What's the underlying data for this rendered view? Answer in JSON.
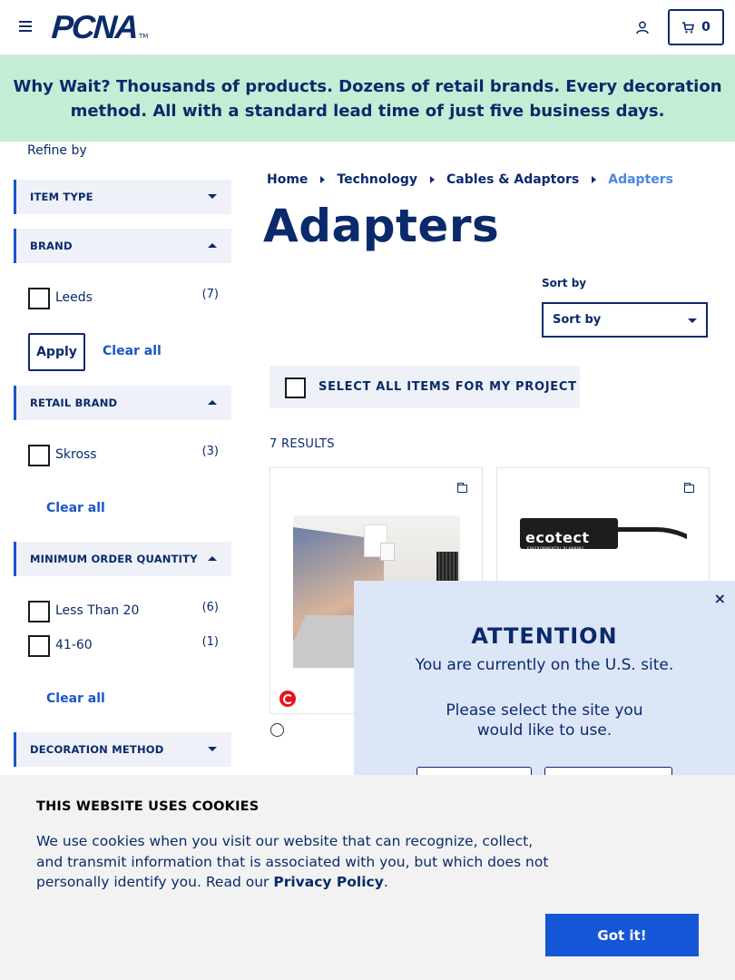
{
  "header": {
    "logo_text": "PCNA",
    "logo_tm": "TM",
    "cart_count": "0"
  },
  "promo": {
    "lead": "Why Wait?",
    "text": " Thousands of products. Dozens of retail brands. Every decoration method. All with a standard lead time of just five business days."
  },
  "sidebar": {
    "refine_label": "Refine by",
    "facets": {
      "item_type": {
        "label": "ITEM TYPE"
      },
      "brand": {
        "label": "BRAND",
        "options": [
          {
            "label": "Leeds",
            "count": "(7)"
          }
        ],
        "apply_label": "Apply",
        "clear_label": "Clear all"
      },
      "retail_brand": {
        "label": "RETAIL BRAND",
        "options": [
          {
            "label": "Skross",
            "count": "(3)"
          }
        ],
        "clear_label": "Clear all"
      },
      "min_order": {
        "label": "MINIMUM ORDER QUANTITY",
        "options": [
          {
            "label": "Less Than 20",
            "count": "(6)"
          },
          {
            "label": "41-60",
            "count": "(1)"
          }
        ],
        "clear_label": "Clear all"
      },
      "decoration": {
        "label": "DECORATION METHOD"
      }
    }
  },
  "main": {
    "breadcrumb": [
      "Home",
      "Technology",
      "Cables & Adaptors",
      "Adapters"
    ],
    "title": "Adapters",
    "sort_label": "Sort by",
    "sort_value": "Sort by",
    "select_all_label": "SELECT ALL ITEMS FOR MY PROJECT",
    "results": "7 RESULTS",
    "products": [
      {
        "image_brand": ""
      },
      {
        "image_brand": "ecotect",
        "image_sub": "ENVIRONMENTAL PLANNING"
      }
    ]
  },
  "modal": {
    "title": "ATTENTION",
    "line1": "You are currently on the U.S. site.",
    "line2a": "Please select the site you",
    "line2b": "would like to use.",
    "close": "×"
  },
  "cookie": {
    "title": "THIS WEBSITE USES COOKIES",
    "body": "We use cookies when you visit our website that can recognize, collect, and transmit information that is associated with you, but which does not personally identify you. Read our ",
    "link": "Privacy Policy",
    "end": ".",
    "button": "Got it!"
  },
  "colors": {
    "navy": "#0a2a6b",
    "accent": "#1956c8",
    "promo_bg": "#c3eed5",
    "button_blue": "#1556d6"
  }
}
